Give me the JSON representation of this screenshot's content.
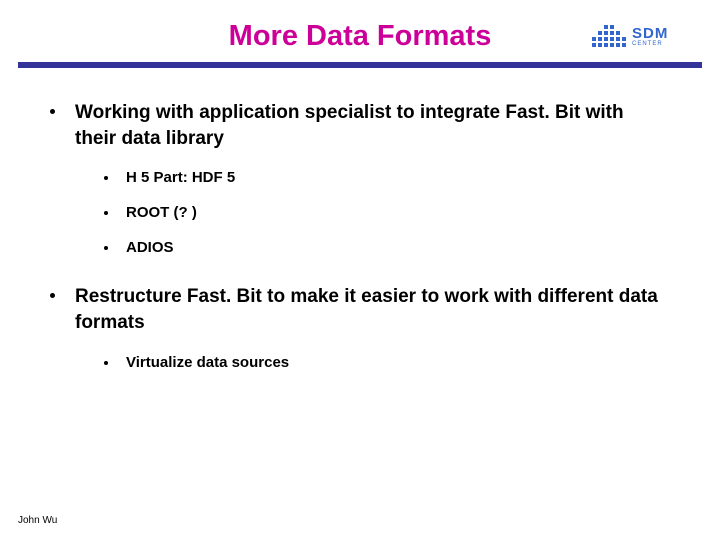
{
  "title": "More Data Formats",
  "logo": {
    "main": "SDM",
    "sub": "CENTER"
  },
  "bullets": [
    {
      "text": "Working with application specialist to integrate Fast. Bit with their data library",
      "sub": [
        "H 5 Part: HDF 5",
        "ROOT (? )",
        "ADIOS"
      ]
    },
    {
      "text": "Restructure Fast. Bit to make it easier to work with different data formats",
      "sub": [
        "Virtualize data sources"
      ]
    }
  ],
  "footer": "John Wu"
}
